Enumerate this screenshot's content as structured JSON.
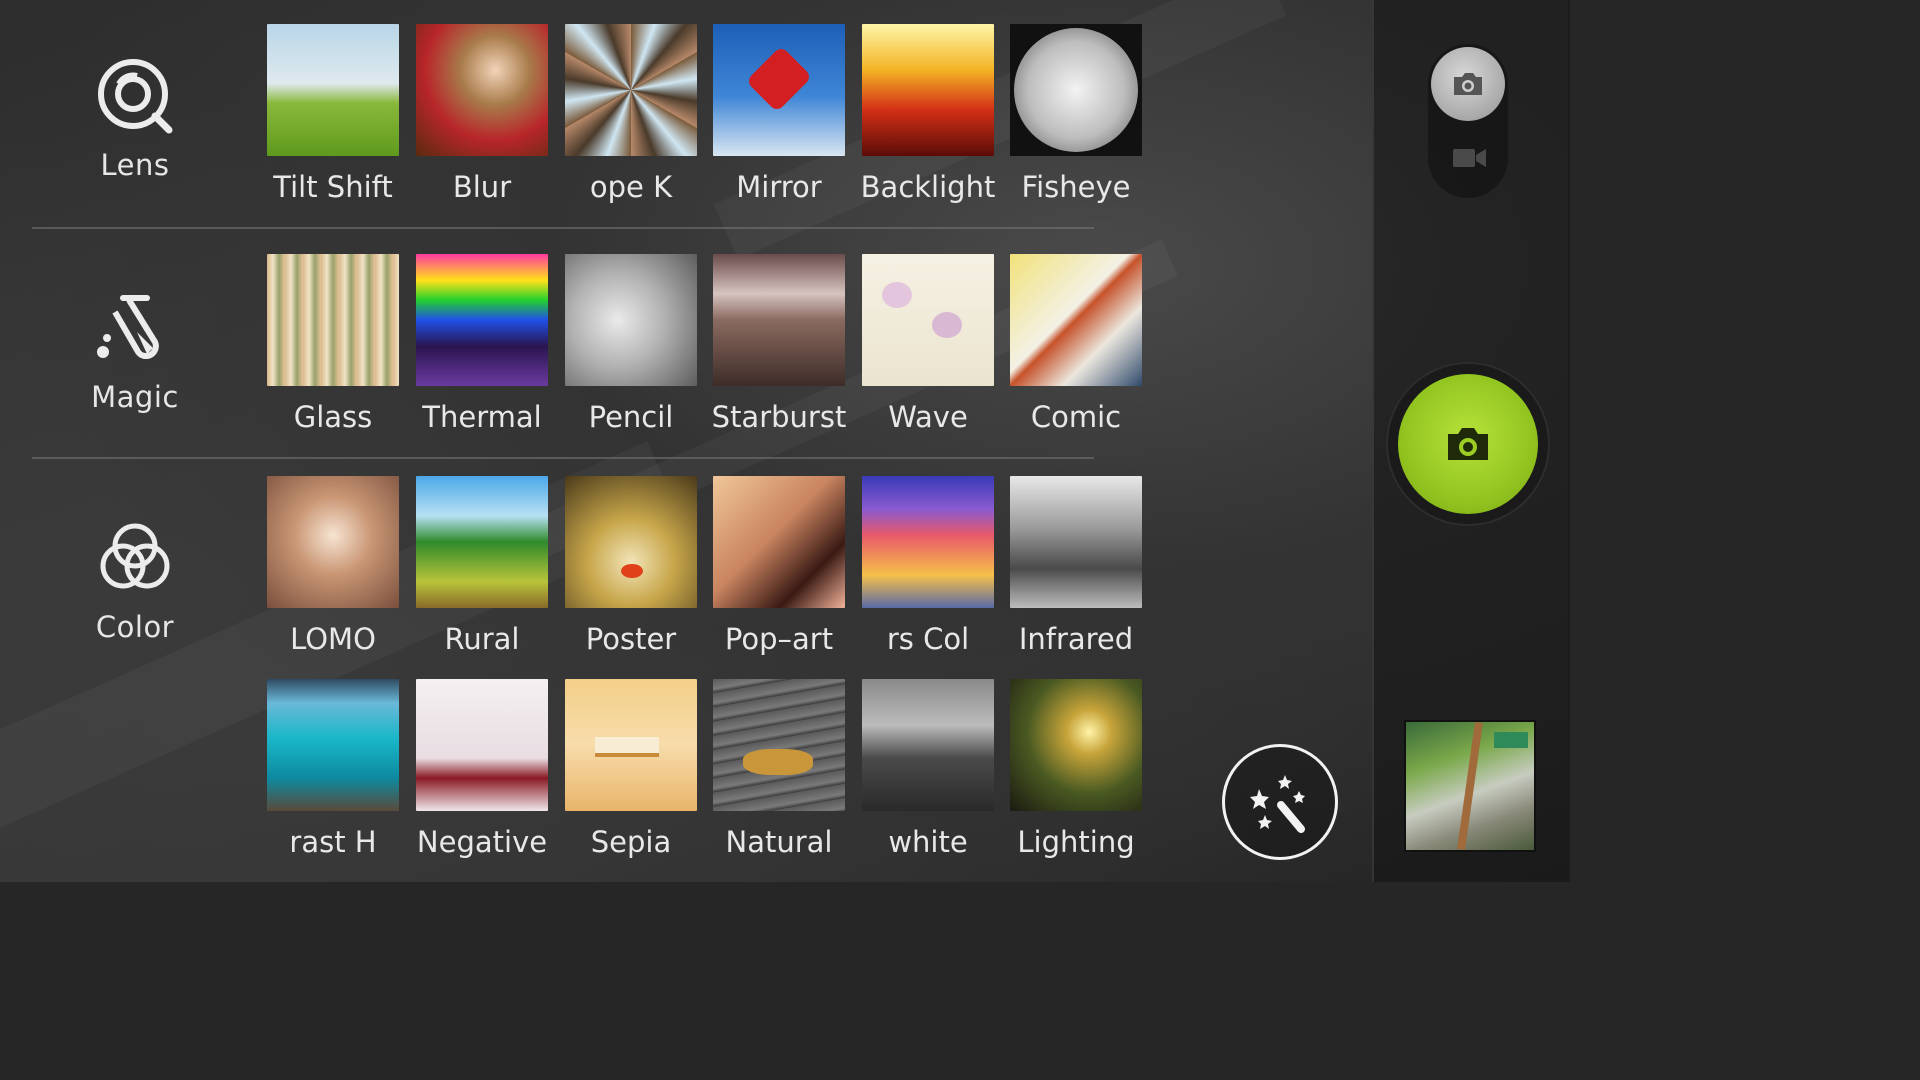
{
  "categories": [
    {
      "label": "Lens",
      "icon": "lens-icon"
    },
    {
      "label": "Magic",
      "icon": "flask-icon"
    },
    {
      "label": "Color",
      "icon": "color-circles-icon"
    }
  ],
  "rows": [
    {
      "filters": [
        {
          "label": "Tilt Shift"
        },
        {
          "label": "Blur"
        },
        {
          "label": "ope     K"
        },
        {
          "label": "Mirror"
        },
        {
          "label": "Backlight"
        },
        {
          "label": "Fisheye"
        }
      ]
    },
    {
      "filters": [
        {
          "label": "Glass"
        },
        {
          "label": "Thermal"
        },
        {
          "label": "Pencil"
        },
        {
          "label": "Starburst"
        },
        {
          "label": "Wave"
        },
        {
          "label": "Comic"
        }
      ]
    },
    {
      "filters": [
        {
          "label": "LOMO"
        },
        {
          "label": "Rural"
        },
        {
          "label": "Poster"
        },
        {
          "label": "Pop–art"
        },
        {
          "label": "rs     Col"
        },
        {
          "label": "Infrared"
        }
      ]
    },
    {
      "filters": [
        {
          "label": "rast     H"
        },
        {
          "label": "Negative"
        },
        {
          "label": "Sepia"
        },
        {
          "label": "Natural"
        },
        {
          "label": "white"
        },
        {
          "label": "Lighting"
        }
      ]
    }
  ],
  "controls": {
    "photo_mode_icon": "camera-icon",
    "video_mode_icon": "video-camera-icon",
    "shutter_icon": "camera-icon",
    "magic_icon": "magic-wand-icon",
    "accent_color": "#93c521"
  }
}
